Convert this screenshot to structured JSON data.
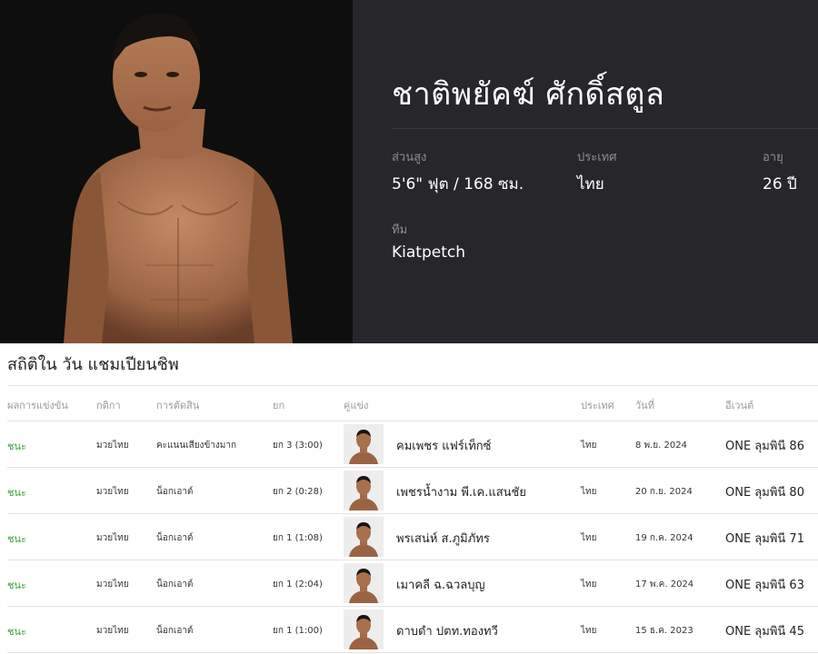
{
  "fighter": {
    "name": "ชาติพยัคฆ์ ศักดิ์สตูล",
    "height_label": "ส่วนสูง",
    "height_value": "5'6\" ฟุต / 168 ซม.",
    "country_label": "ประเทศ",
    "country_value": "ไทย",
    "age_label": "อายุ",
    "age_value": "26 ปี",
    "team_label": "ทีม",
    "team_value": "Kiatpetch"
  },
  "stats": {
    "title": "สถิติใน วัน แชมเปียนชิพ",
    "headers": {
      "result": "ผลการแข่งขัน",
      "rules": "กติกา",
      "method": "การตัดสิน",
      "round": "ยก",
      "opponent": "คู่แข่ง",
      "country": "ประเทศ",
      "date": "วันที่",
      "event": "อีเวนต์"
    },
    "rows": [
      {
        "result": "ชนะ",
        "rules": "มวยไทย",
        "method": "คะแนนเสียงข้างมาก",
        "round": "ยก 3 (3:00)",
        "opponent": "คมเพชร แฟร์เท็กซ์",
        "country": "ไทย",
        "date": "8 พ.ย. 2024",
        "event": "ONE ลุมพินี 86"
      },
      {
        "result": "ชนะ",
        "rules": "มวยไทย",
        "method": "น็อกเอาต์",
        "round": "ยก 2 (0:28)",
        "opponent": "เพชรน้ำงาม พี.เค.แสนชัย",
        "country": "ไทย",
        "date": "20 ก.ย. 2024",
        "event": "ONE ลุมพินี 80"
      },
      {
        "result": "ชนะ",
        "rules": "มวยไทย",
        "method": "น็อกเอาต์",
        "round": "ยก 1 (1:08)",
        "opponent": "พรเสน่ห์ ส.ภูมิภัทร",
        "country": "ไทย",
        "date": "19 ก.ค. 2024",
        "event": "ONE ลุมพินี 71"
      },
      {
        "result": "ชนะ",
        "rules": "มวยไทย",
        "method": "น็อกเอาต์",
        "round": "ยก 1 (2:04)",
        "opponent": "เมาคลี ฉ.ฉวลบุญ",
        "country": "ไทย",
        "date": "17 พ.ค. 2024",
        "event": "ONE ลุมพินี 63"
      },
      {
        "result": "ชนะ",
        "rules": "มวยไทย",
        "method": "น็อกเอาต์",
        "round": "ยก 1 (1:00)",
        "opponent": "ดาบดำ ปตท.ทองทวี",
        "country": "ไทย",
        "date": "15 ธ.ค. 2023",
        "event": "ONE ลุมพินี 45"
      }
    ]
  },
  "colors": {
    "hero_bg": "#27272b",
    "photo_bg": "#0e0e0e",
    "win": "#3a9b3a"
  }
}
